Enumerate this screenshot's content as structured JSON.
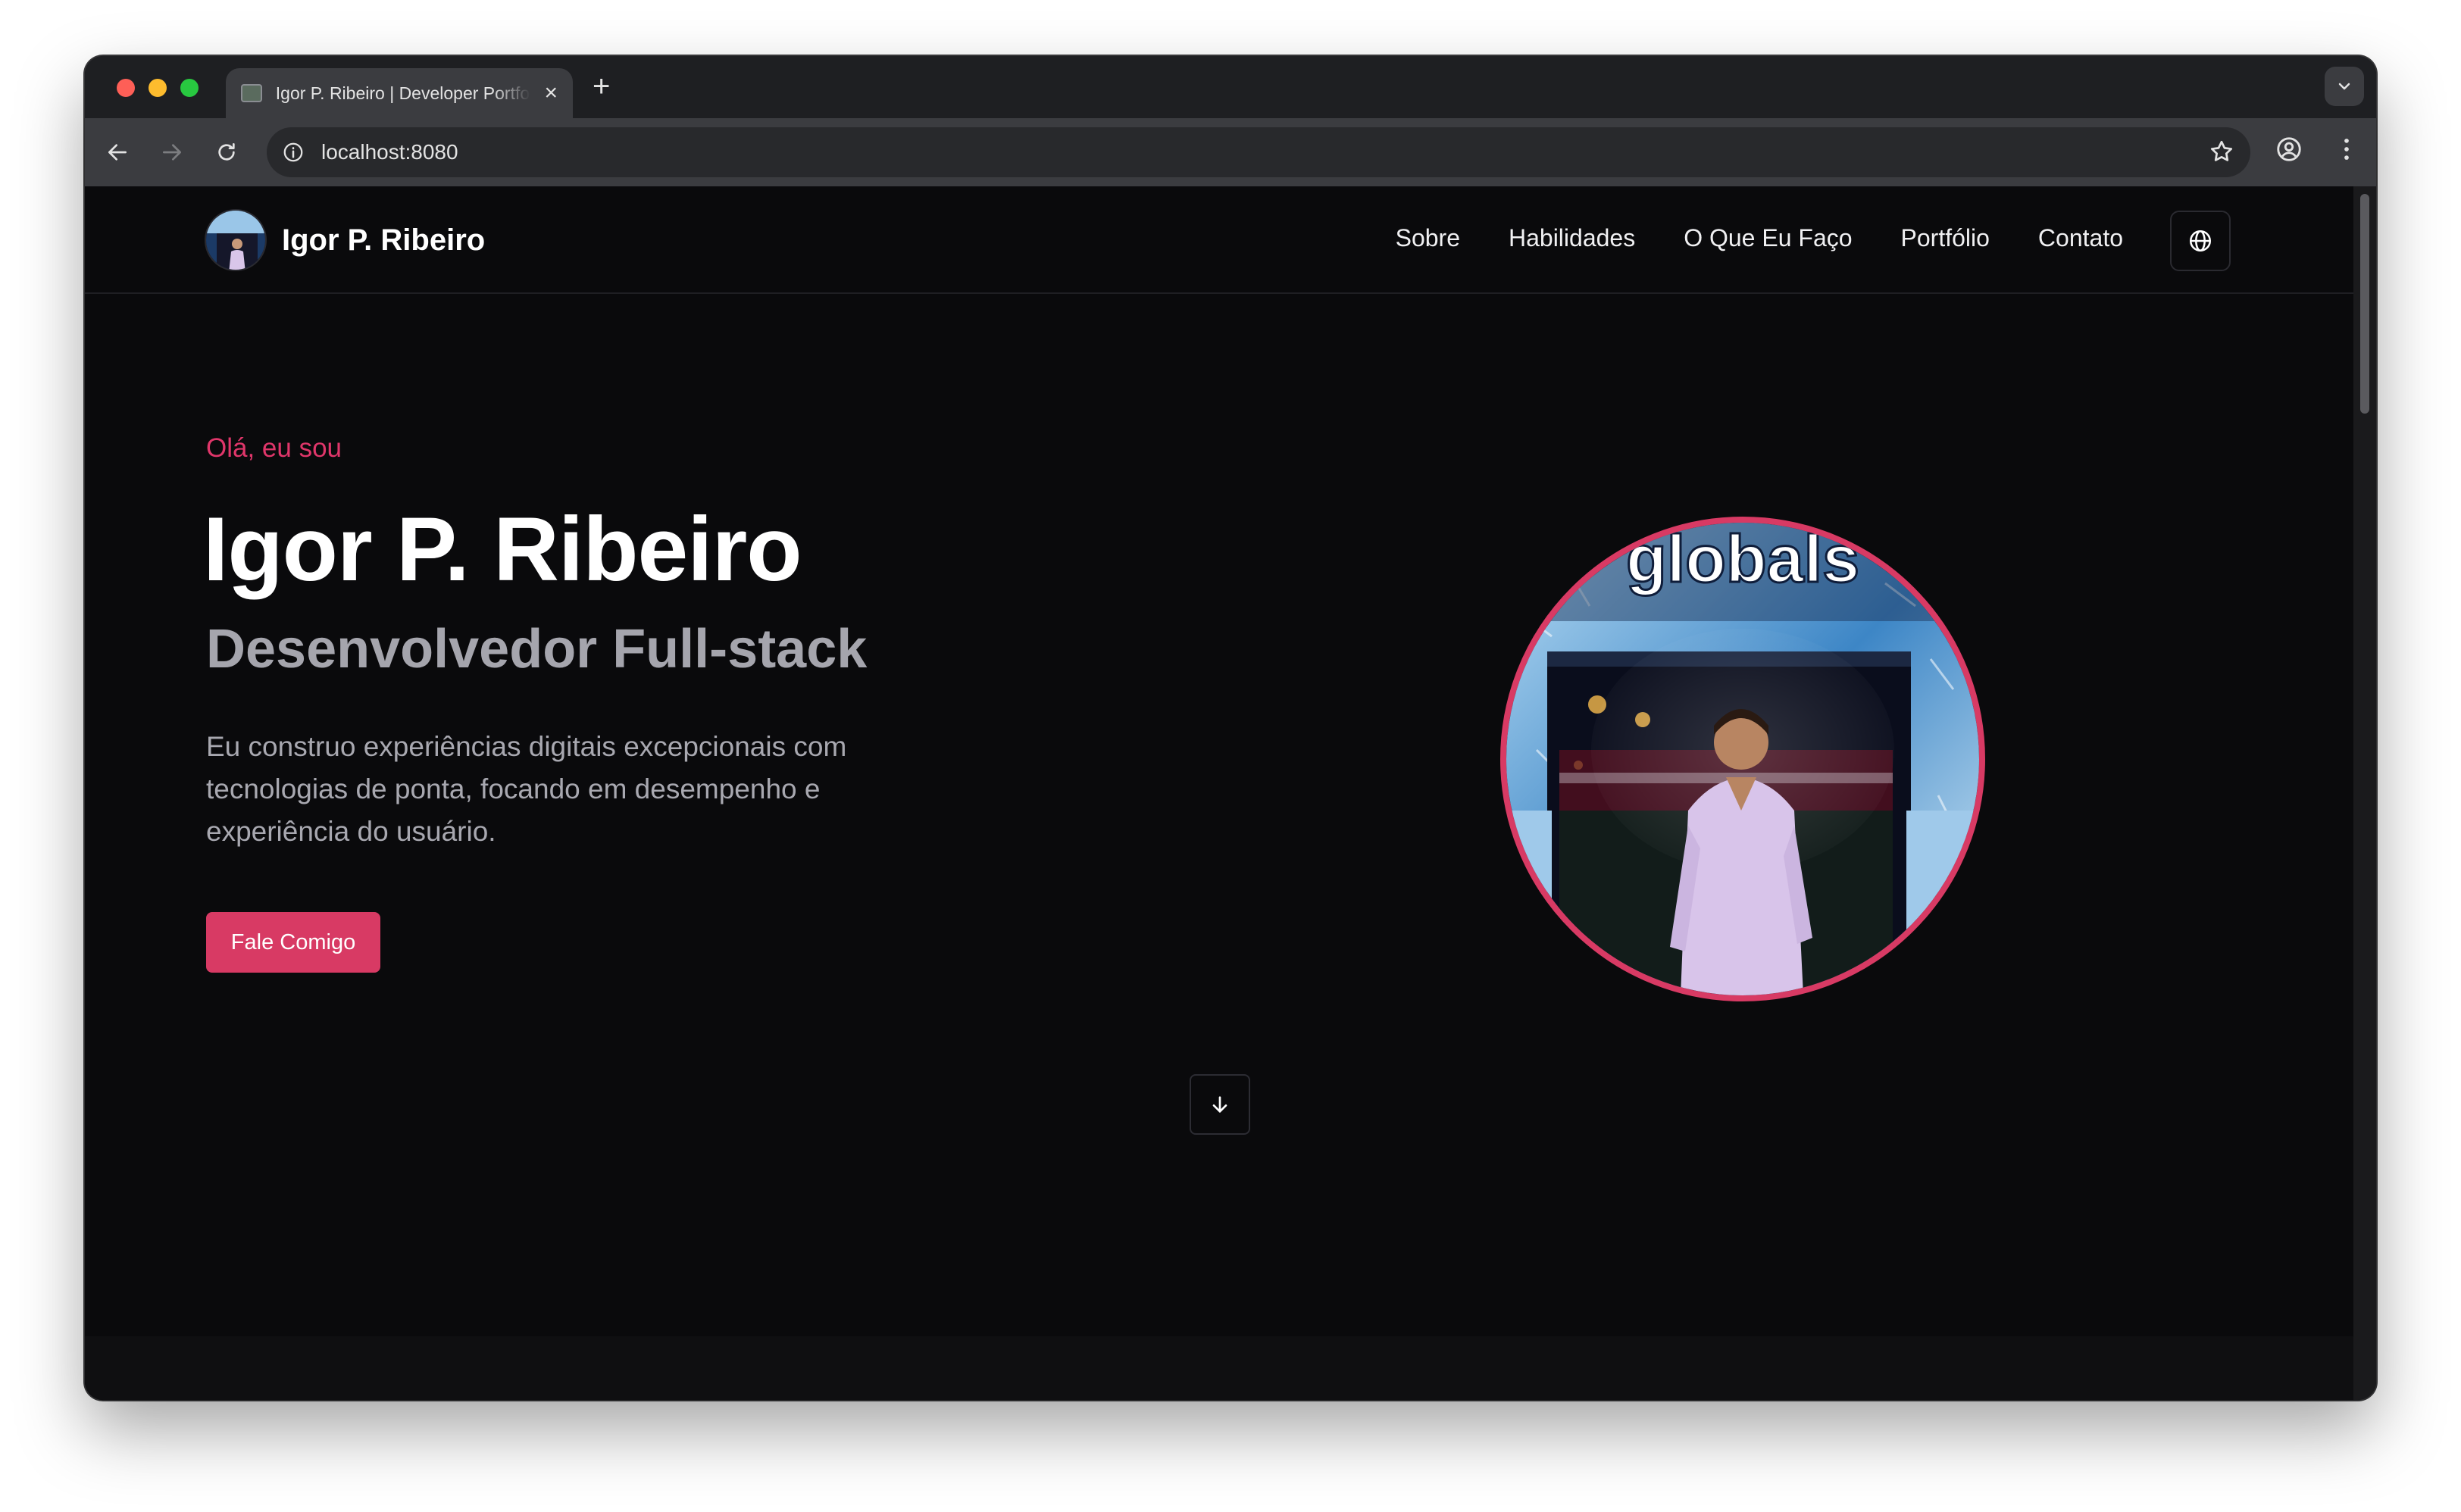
{
  "browser": {
    "tab_title": "Igor P. Ribeiro | Developer Portfolio",
    "url": "localhost:8080"
  },
  "site": {
    "brand_name": "Igor P. Ribeiro",
    "nav": [
      "Sobre",
      "Habilidades",
      "O Que Eu Faço",
      "Portfólio",
      "Contato"
    ]
  },
  "hero": {
    "greeting": "Olá, eu sou",
    "name": "Igor P. Ribeiro",
    "role": "Desenvolvedor Full-stack",
    "description": "Eu construo experiências digitais excepcionais com tecnologias de ponta, focando em desempenho e experiência do usuário.",
    "cta_label": "Fale Comigo",
    "photo_sign_text": "globals"
  },
  "icons": [
    "globe-icon",
    "arrow-down-icon",
    "star-icon",
    "profile-icon",
    "more-icon",
    "back-icon",
    "forward-icon",
    "reload-icon",
    "info-icon"
  ],
  "colors": {
    "accent": "#d83a64",
    "background": "#0a0a0c",
    "muted_text": "#a5a5ad"
  }
}
